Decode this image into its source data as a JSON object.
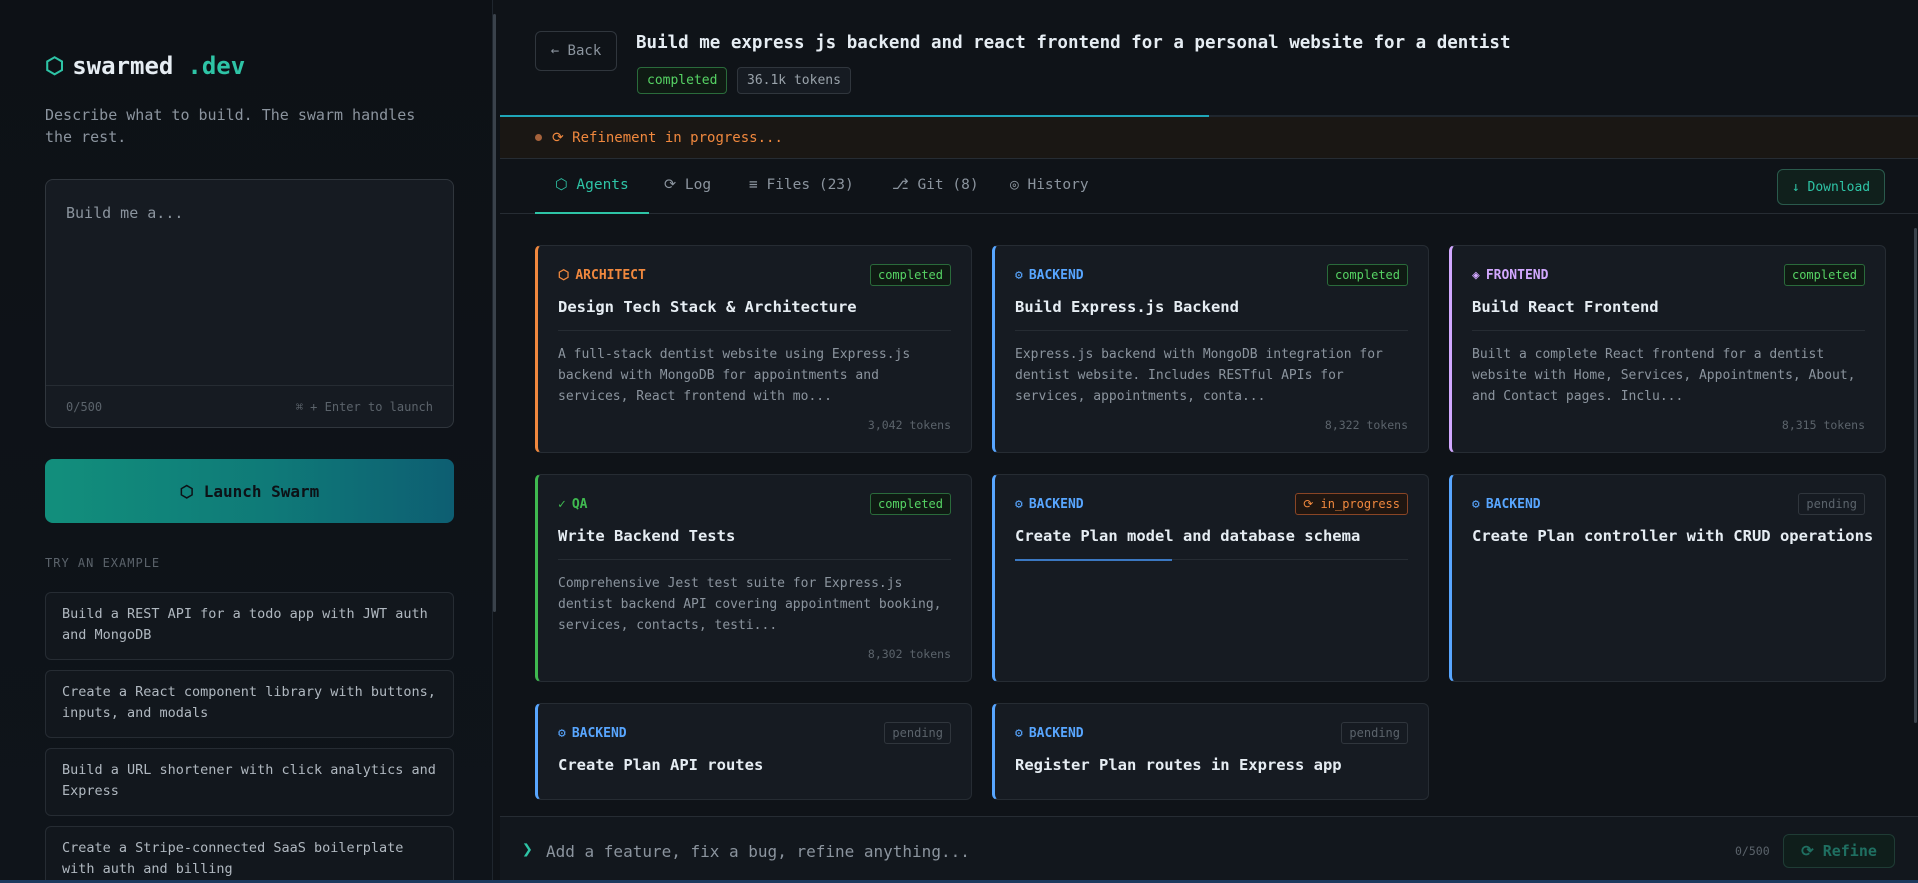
{
  "sidebar": {
    "logo_name": "swarmed",
    "logo_tld": ".dev",
    "tagline": "Describe what to build. The swarm handles the rest.",
    "prompt_placeholder": "Build me a...",
    "char_count": "0/500",
    "shortcut_hint": "⌘ + Enter to launch",
    "launch_label": "Launch Swarm",
    "examples_label": "TRY AN EXAMPLE",
    "examples": [
      "Build a REST API for a todo app with JWT auth and MongoDB",
      "Create a React component library with buttons, inputs, and modals",
      "Build a URL shortener with click analytics and Express",
      "Create a Stripe-connected SaaS boilerplate with auth and billing"
    ]
  },
  "header": {
    "back_label": "← Back",
    "title": "Build me express js backend and react frontend for a personal website for a dentist",
    "status": "completed",
    "tokens": "36.1k tokens",
    "progress": 0.5
  },
  "banner": {
    "text": "⟳ Refinement in progress..."
  },
  "tabs": [
    {
      "label": "⬡ Agents",
      "active": true
    },
    {
      "label": "⟳ Log"
    },
    {
      "label": "≡ Files (23)"
    },
    {
      "label": "⎇ Git (8)"
    },
    {
      "label": "◎ History"
    }
  ],
  "download_label": "↓ Download",
  "cards": [
    {
      "role": "ARCHITECT",
      "role_icon": "⬡",
      "status": "completed",
      "title": "Design Tech Stack & Architecture",
      "desc": "A full-stack dentist website using Express.js backend with MongoDB for appointments and services, React frontend with mo...",
      "tokens": "3,042 tokens"
    },
    {
      "role": "BACKEND",
      "role_icon": "⚙",
      "status": "completed",
      "title": "Build Express.js Backend",
      "desc": "Express.js backend with MongoDB integration for dentist website. Includes RESTful APIs for services, appointments, conta...",
      "tokens": "8,322 tokens"
    },
    {
      "role": "FRONTEND",
      "role_icon": "◈",
      "status": "completed",
      "title": "Build React Frontend",
      "desc": "Built a complete React frontend for a dentist website with Home, Services, Appointments, About, and Contact pages. Inclu...",
      "tokens": "8,315 tokens"
    },
    {
      "role": "QA",
      "role_icon": "✓",
      "status": "completed",
      "title": "Write Backend Tests",
      "desc": "Comprehensive Jest test suite for Express.js dentist backend API covering appointment booking, services, contacts, testi...",
      "tokens": "8,302 tokens"
    },
    {
      "role": "BACKEND",
      "role_icon": "⚙",
      "status": "⟳ in_progress",
      "title": "Create Plan model and database schema",
      "desc": "",
      "tokens": ""
    },
    {
      "role": "BACKEND",
      "role_icon": "⚙",
      "status": "pending",
      "title": "Create Plan controller with CRUD operations",
      "desc": "",
      "tokens": ""
    },
    {
      "role": "BACKEND",
      "role_icon": "⚙",
      "status": "pending",
      "title": "Create Plan API routes",
      "desc": "",
      "tokens": ""
    },
    {
      "role": "BACKEND",
      "role_icon": "⚙",
      "status": "pending",
      "title": "Register Plan routes in Express app",
      "desc": "",
      "tokens": ""
    }
  ],
  "refine": {
    "placeholder": "Add a feature, fix a bug, refine anything...",
    "count": "0/500",
    "button_label": "⟳ Refine"
  }
}
